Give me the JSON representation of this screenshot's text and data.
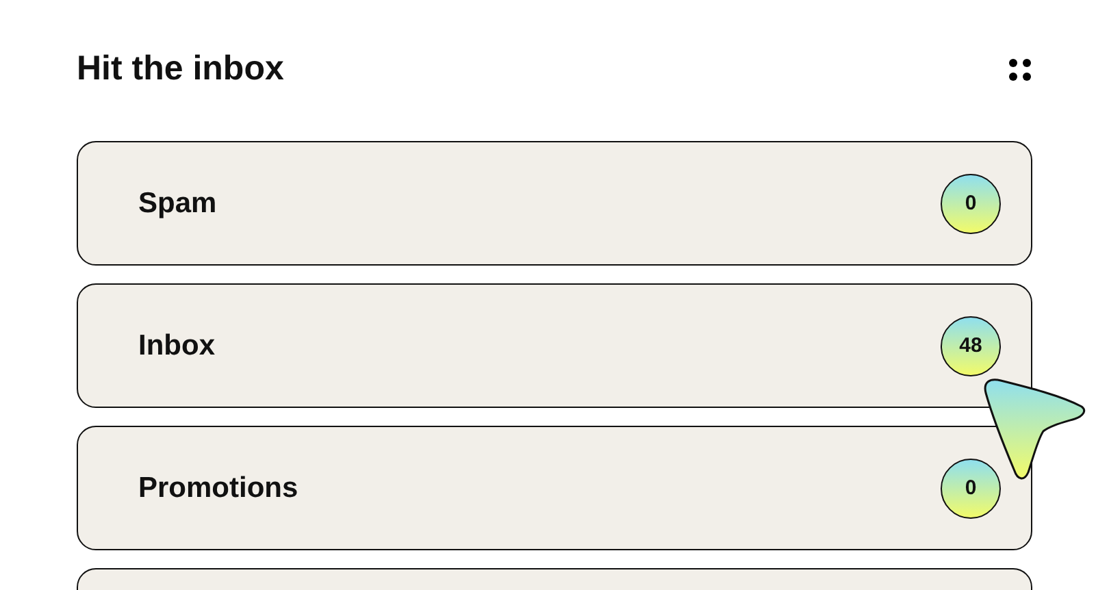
{
  "title": "Hit the inbox",
  "folders": [
    {
      "label": "Spam",
      "count": "0"
    },
    {
      "label": "Inbox",
      "count": "48"
    },
    {
      "label": "Promotions",
      "count": "0"
    }
  ]
}
